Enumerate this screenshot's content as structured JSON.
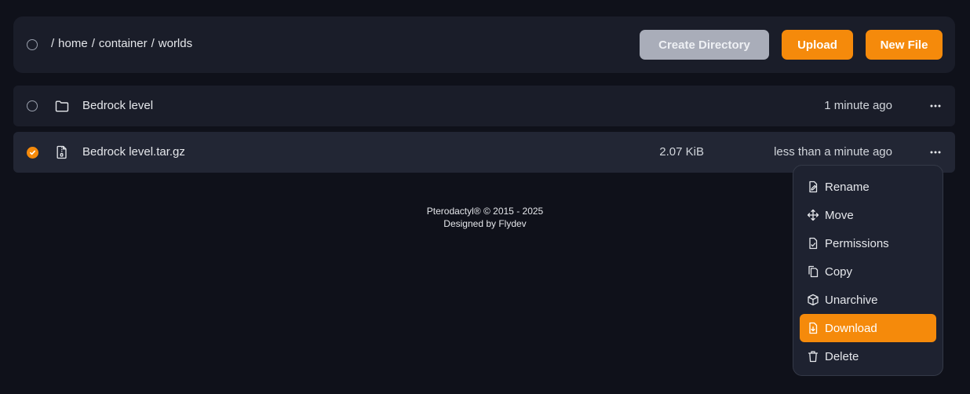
{
  "toolbar": {
    "breadcrumb": [
      "/",
      "home",
      "/",
      "container",
      "/",
      "worlds"
    ],
    "create_directory_label": "Create Directory",
    "upload_label": "Upload",
    "new_file_label": "New File"
  },
  "files": [
    {
      "name": "Bedrock level",
      "type": "folder-icon",
      "size": "",
      "modified": "1 minute ago",
      "selected": false
    },
    {
      "name": "Bedrock level.tar.gz",
      "type": "archive-file-icon",
      "size": "2.07 KiB",
      "modified": "less than a minute ago",
      "selected": true
    }
  ],
  "footer": {
    "line1": "Pterodactyl® © 2015 - 2025",
    "line2": "Designed by Flydev"
  },
  "context_menu": {
    "items": [
      {
        "label": "Rename",
        "icon": "rename-icon"
      },
      {
        "label": "Move",
        "icon": "move-icon"
      },
      {
        "label": "Permissions",
        "icon": "permissions-icon"
      },
      {
        "label": "Copy",
        "icon": "copy-icon"
      },
      {
        "label": "Unarchive",
        "icon": "unarchive-icon"
      },
      {
        "label": "Download",
        "icon": "download-icon",
        "highlighted": true
      },
      {
        "label": "Delete",
        "icon": "delete-icon"
      }
    ]
  },
  "colors": {
    "background": "#0f111a",
    "panel": "#1a1d29",
    "accent": "#f58a0b",
    "disabled_button": "#a9adb9"
  }
}
